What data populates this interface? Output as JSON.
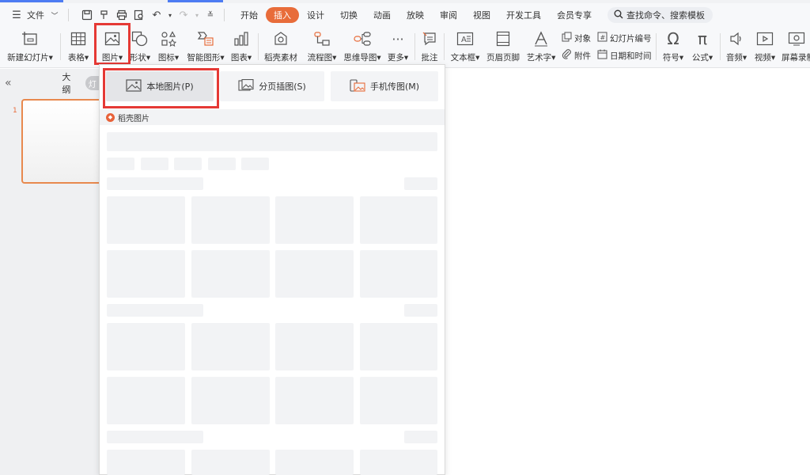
{
  "menubar": {
    "file_label": "文件",
    "tabs": [
      {
        "label": "开始"
      },
      {
        "label": "插入"
      },
      {
        "label": "设计"
      },
      {
        "label": "切换"
      },
      {
        "label": "动画"
      },
      {
        "label": "放映"
      },
      {
        "label": "审阅"
      },
      {
        "label": "视图"
      },
      {
        "label": "开发工具"
      },
      {
        "label": "会员专享"
      }
    ],
    "active_tab": "插入",
    "search_placeholder": "查找命令、搜索模板"
  },
  "ribbon": {
    "new_slide": "新建幻灯片",
    "table": "表格",
    "picture": "图片",
    "shape": "形状",
    "icon": "图标",
    "smart_graphic": "智能图形",
    "chart": "图表",
    "docer_material": "稻壳素材",
    "flowchart": "流程图",
    "mindmap": "思维导图",
    "more": "更多",
    "comment": "批注",
    "textbox": "文本框",
    "header_footer": "页眉页脚",
    "wordart": "艺术字",
    "object": "对象",
    "slide_number": "幻灯片编号",
    "attachment": "附件",
    "date_time": "日期和时间",
    "symbol": "符号",
    "formula": "公式",
    "audio": "音频",
    "video": "视频",
    "screen_record": "屏幕录制"
  },
  "leftpane": {
    "outline_tab": "大纲",
    "slides_tab": "幻灯片",
    "slide_number": "1"
  },
  "picture_menu": {
    "local_picture": "本地图片(P)",
    "paged_insert": "分页插图(S)",
    "phone_transfer": "手机传图(M)",
    "docer_section": "稻壳图片"
  }
}
